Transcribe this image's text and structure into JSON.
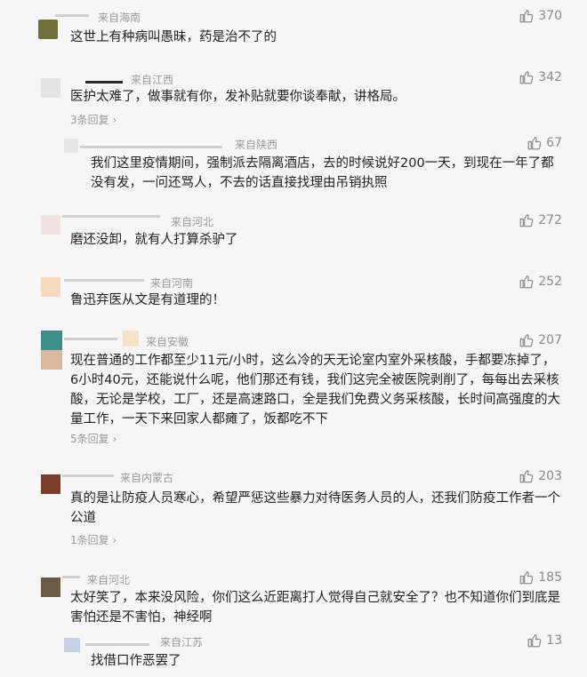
{
  "comments": [
    {
      "source": "来自海南",
      "text": "这世上有种病叫愚昧，药是治不了的",
      "likes": "370"
    },
    {
      "source": "来自江西",
      "text": "医护太难了，做事就有你，发补贴就要你谈奉献，讲格局。",
      "likes": "342",
      "more": "3条回复 ›"
    },
    {
      "source": "来自陕西",
      "text": "我们这里疫情期间，强制派去隔离酒店，去的时候说好200一天，到现在一年了都没有发，一问还骂人，不去的话直接找理由吊销执照",
      "likes": "67"
    },
    {
      "source": "来自河北",
      "text": "磨还没卸，就有人打算杀驴了",
      "likes": "272"
    },
    {
      "source": "来自河南",
      "text": "鲁迅弃医从文是有道理的！",
      "likes": "252"
    },
    {
      "source": "来自安徽",
      "text": "现在普通的工作都至少11元/小时，这么冷的天无论室内室外采核酸，手都要冻掉了，6小时40元，还能说什么呢，他们那还有钱，我们这完全被医院剥削了，每每出去采核酸，无论是学校，工厂，还是高速路口，全是我们免费义务采核酸，长时间高强度的大量工作，一天下来回家人都瘫了，饭都吃不下",
      "likes": "207",
      "more": "5条回复 ›"
    },
    {
      "source": "来自内蒙古",
      "text": "真的是让防疫人员寒心，希望严惩这些暴力对待医务人员的人，还我们防疫工作者一个公道",
      "likes": "203",
      "more": "1条回复 ›"
    },
    {
      "source": "来自河北",
      "text": "太好笑了，本来没风险，你们这么近距离打人觉得自己就安全了？也不知道你们到底是害怕还是不害怕，神经啊",
      "likes": "185"
    },
    {
      "source": "来自江苏",
      "text": "找借口作恶罢了",
      "likes": "13"
    }
  ],
  "colors": {
    "background": "#f6f6f6",
    "text": "#222222",
    "meta": "#9a9a9a"
  },
  "icons": {
    "like": "thumbs-up-icon"
  }
}
